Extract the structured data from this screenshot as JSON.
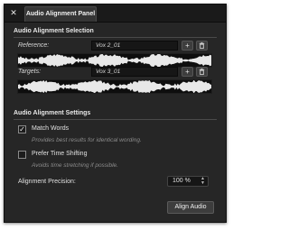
{
  "window": {
    "close_glyph": "✕",
    "tab_title": "Audio Alignment Panel"
  },
  "selection": {
    "title": "Audio Alignment Selection",
    "reference_label": "Reference:",
    "reference_value": "Vox 2_01",
    "targets_label": "Targets:",
    "targets_value": "Vox 3_01",
    "add_glyph": "+",
    "delete_icon": "trash-icon"
  },
  "settings": {
    "title": "Audio Alignment Settings",
    "match_words": {
      "label": "Match Words",
      "checked": true,
      "hint": "Provides best results for identical wording."
    },
    "prefer_time_shifting": {
      "label": "Prefer Time Shifting",
      "checked": false,
      "hint": "Avoids time stretching if possible."
    },
    "precision_label": "Alignment Precision:",
    "precision_value": "100 %"
  },
  "actions": {
    "align_label": "Align Audio"
  },
  "colors": {
    "panel_bg": "#262626",
    "waveform": "#e8e8e8",
    "waveform_bg": "#0e0e0e"
  }
}
